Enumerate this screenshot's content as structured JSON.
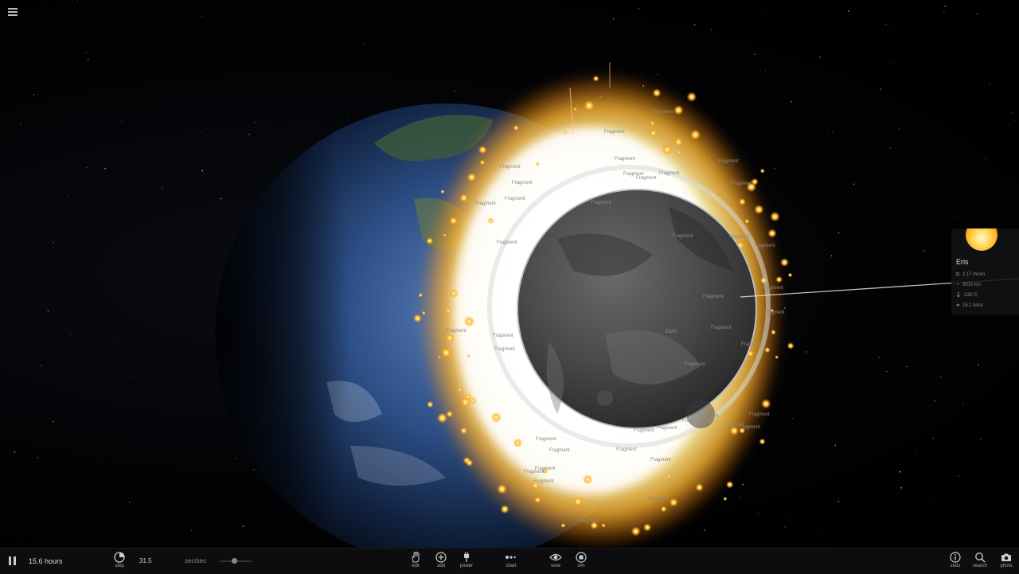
{
  "scene": {
    "fragment_label": "Fragment",
    "earth_label": "Earth",
    "fragment_count": 42
  },
  "info_panel": {
    "name": "Eris",
    "rows": [
      {
        "icon": "mass-icon",
        "value": "2.17 moon"
      },
      {
        "icon": "radius-icon",
        "value": "3010 km"
      },
      {
        "icon": "temperature-icon",
        "value": "-135°C"
      },
      {
        "icon": "velocity-icon",
        "value": "15.1 km/s"
      }
    ]
  },
  "bottom_bar": {
    "time": "15.6 hours",
    "step_label": "step",
    "speed_value": "31.5",
    "speed_unit": "sec/sec",
    "speed_slider_level": 0.45,
    "tools": [
      {
        "name": "edit",
        "label": "edit"
      },
      {
        "name": "add",
        "label": "add"
      },
      {
        "name": "power",
        "label": "power"
      },
      {
        "name": "chart",
        "label": "chart"
      },
      {
        "name": "view",
        "label": "view"
      },
      {
        "name": "sim",
        "label": "sim"
      }
    ],
    "right_tools": [
      {
        "name": "stats",
        "label": "stats"
      },
      {
        "name": "search",
        "label": "search"
      },
      {
        "name": "photo",
        "label": "photo"
      }
    ]
  },
  "colors": {
    "explosion_core": "#ffffff",
    "explosion_mid": "#ffd24a",
    "explosion_edge": "#ff8a10",
    "earth_ocean": "#2c4f86",
    "moon_gray": "#5a5a5a"
  }
}
